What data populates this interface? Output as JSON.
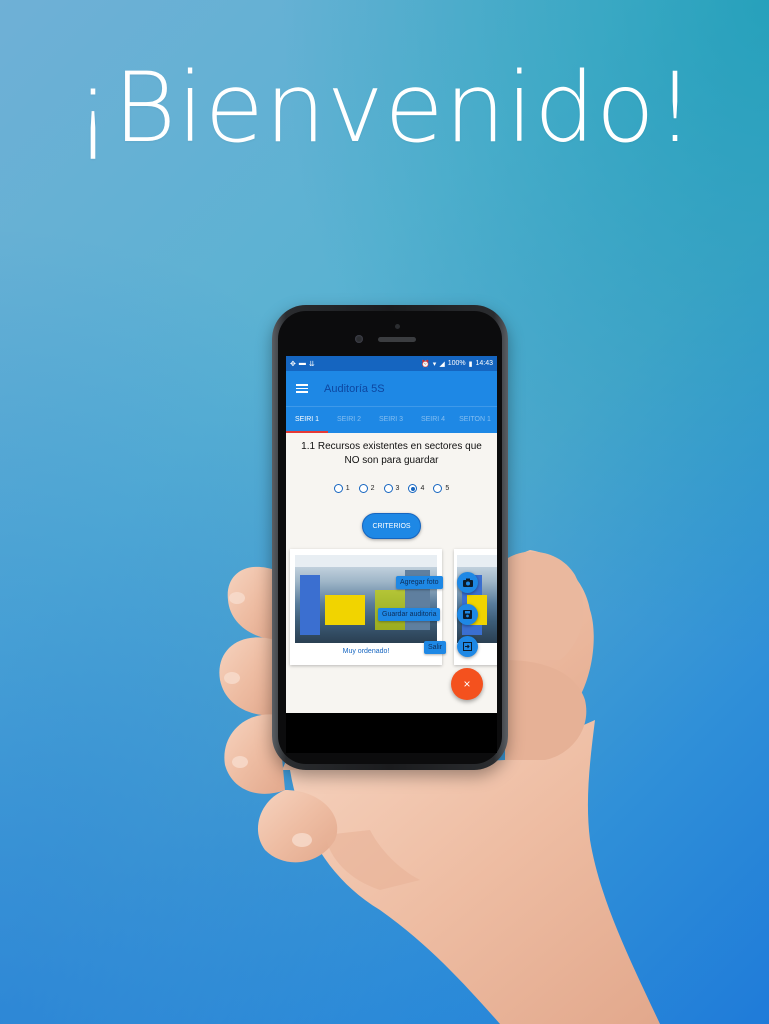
{
  "headline": "¡Bienvenido!",
  "colors": {
    "accent": "#1e88e5",
    "status_bar": "#1565c0",
    "fab": "#f4511e",
    "tab_indicator": "#e53935"
  },
  "status_bar": {
    "time": "14:43",
    "battery": "100%"
  },
  "app_bar": {
    "title": "Auditoría 5S",
    "menu_icon": "hamburger-menu-icon"
  },
  "tabs": [
    {
      "label": "SEIRI 1",
      "active": true
    },
    {
      "label": "SEIRI 2",
      "active": false
    },
    {
      "label": "SEIRI 3",
      "active": false
    },
    {
      "label": "SEIRI 4",
      "active": false
    },
    {
      "label": "SEITON 1",
      "active": false
    }
  ],
  "question": "1.1 Recursos existentes en sectores que NO son para guardar",
  "rating": {
    "options": [
      "1",
      "2",
      "3",
      "4",
      "5"
    ],
    "selected": "4"
  },
  "criterios_label": "CRITERIOS",
  "cards": [
    {
      "caption": "Muy ordenado!"
    }
  ],
  "fab_menu": {
    "add_photo": "Agregar foto",
    "save_audit": "Guardar auditoria",
    "exit": "Salir",
    "close_symbol": "×"
  }
}
